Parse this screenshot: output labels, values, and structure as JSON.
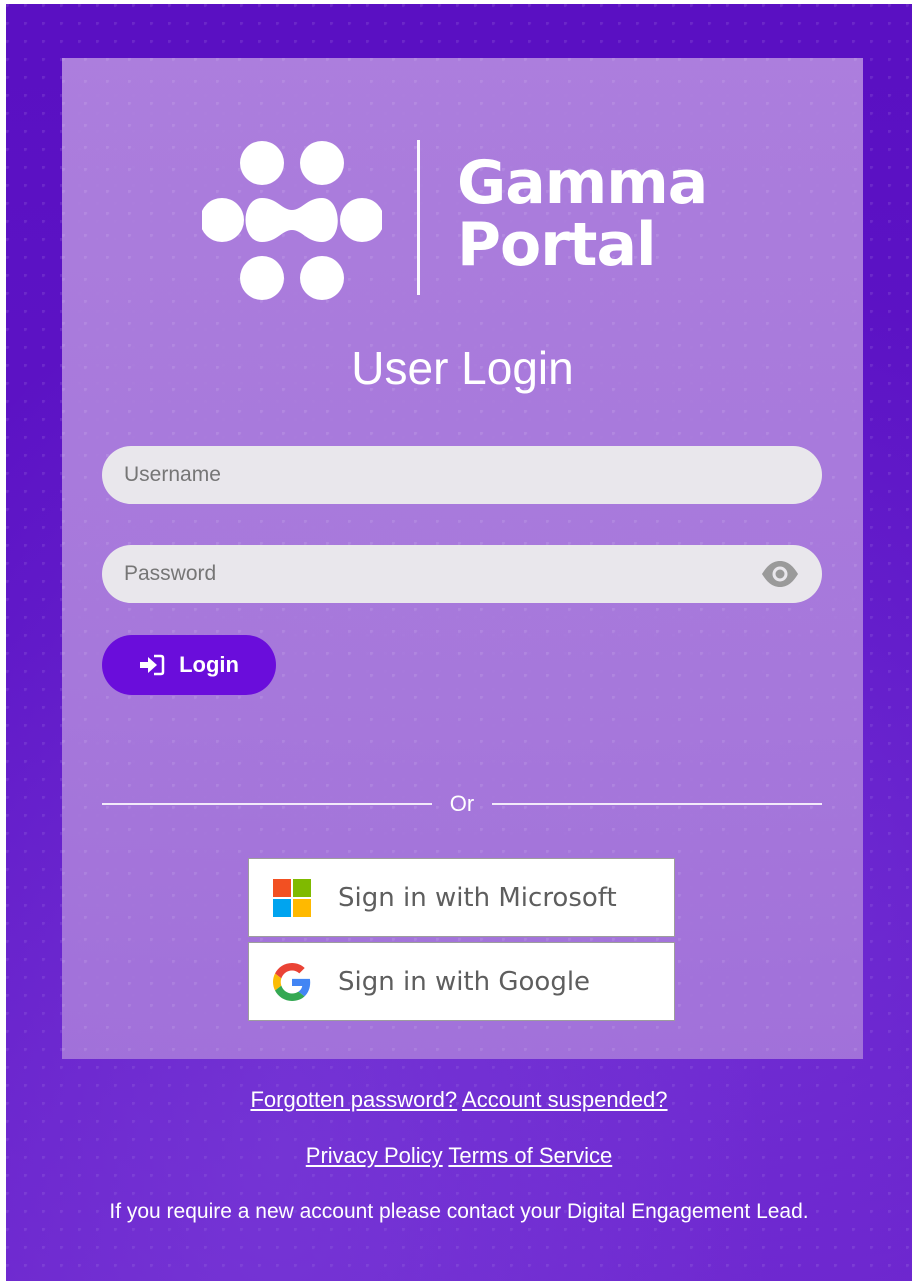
{
  "brand": {
    "name_line1": "Gamma",
    "name_line2": "Portal"
  },
  "login": {
    "title": "User Login",
    "username_placeholder": "Username",
    "username_value": "",
    "password_placeholder": "Password",
    "password_value": "",
    "login_label": "Login",
    "login_icon": "sign-in-icon",
    "show_password_icon": "eye-icon",
    "button_color": "#6a0ddb"
  },
  "divider": {
    "or_label": "Or"
  },
  "sso": {
    "microsoft_label": "Sign in with Microsoft",
    "microsoft_icon": "microsoft-logo-icon",
    "google_label": "Sign in with Google",
    "google_icon": "google-logo-icon"
  },
  "footer": {
    "forgotten_password": "Forgotten password?",
    "account_suspended": "Account suspended?",
    "privacy_policy": "Privacy Policy",
    "terms_of_service": "Terms of Service",
    "new_account_note": "If you require a new account please contact your Digital Engagement Lead."
  },
  "colors": {
    "background": "#5a10c2",
    "card": "#ae82de",
    "accent": "#6a0ddb"
  }
}
